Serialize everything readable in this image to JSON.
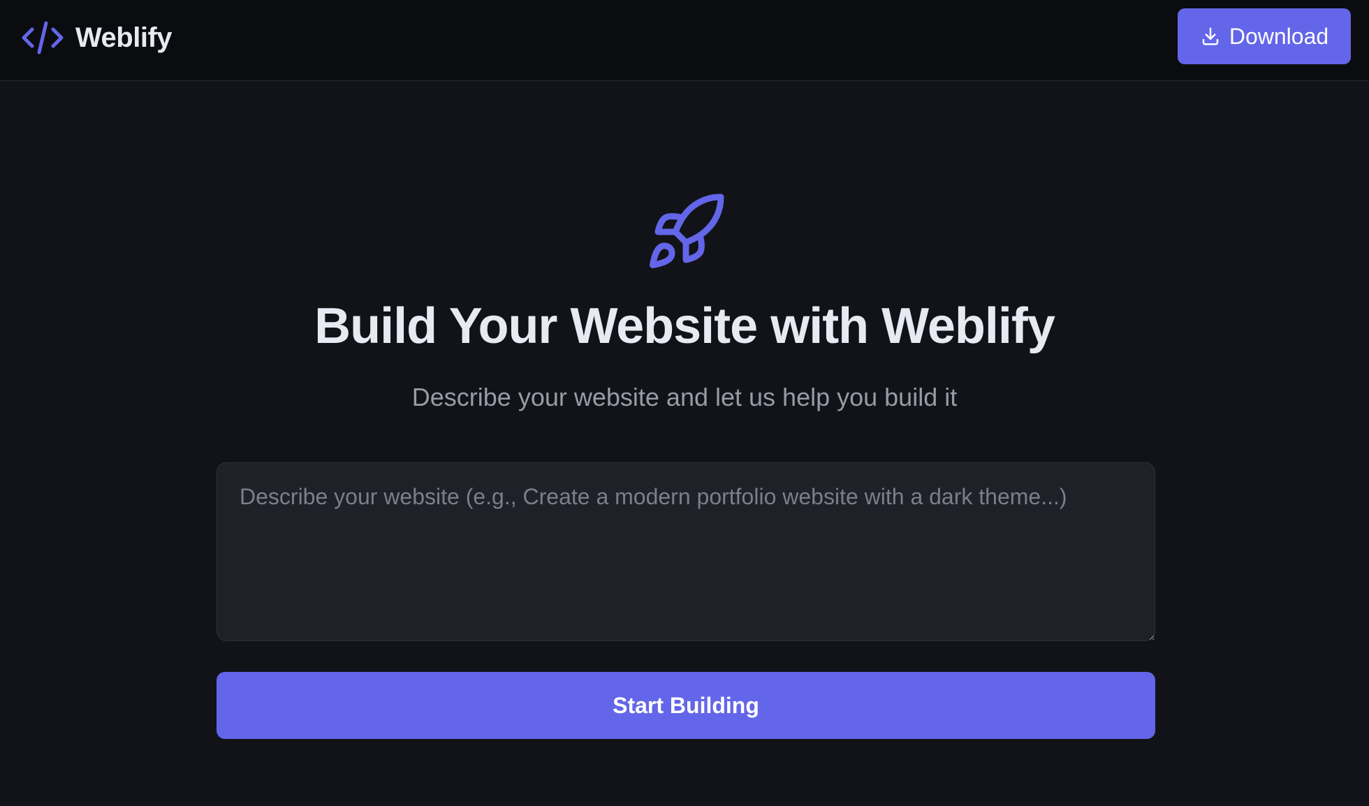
{
  "header": {
    "brand_name": "Weblify",
    "brand_icon": "code-icon",
    "download_label": "Download",
    "download_icon": "download-icon"
  },
  "hero": {
    "icon": "rocket-icon",
    "title": "Build Your Website with Weblify",
    "subtitle": "Describe your website and let us help you build it"
  },
  "prompt": {
    "value": "",
    "placeholder": "Describe your website (e.g., Create a modern portfolio website with a dark theme...)"
  },
  "actions": {
    "start_label": "Start Building"
  },
  "colors": {
    "accent": "#6366e8",
    "background": "#121318",
    "header_background": "#0b0c10",
    "input_background": "#1f2028",
    "text_primary": "#e9e9f3",
    "text_muted": "#9a9aa8"
  }
}
